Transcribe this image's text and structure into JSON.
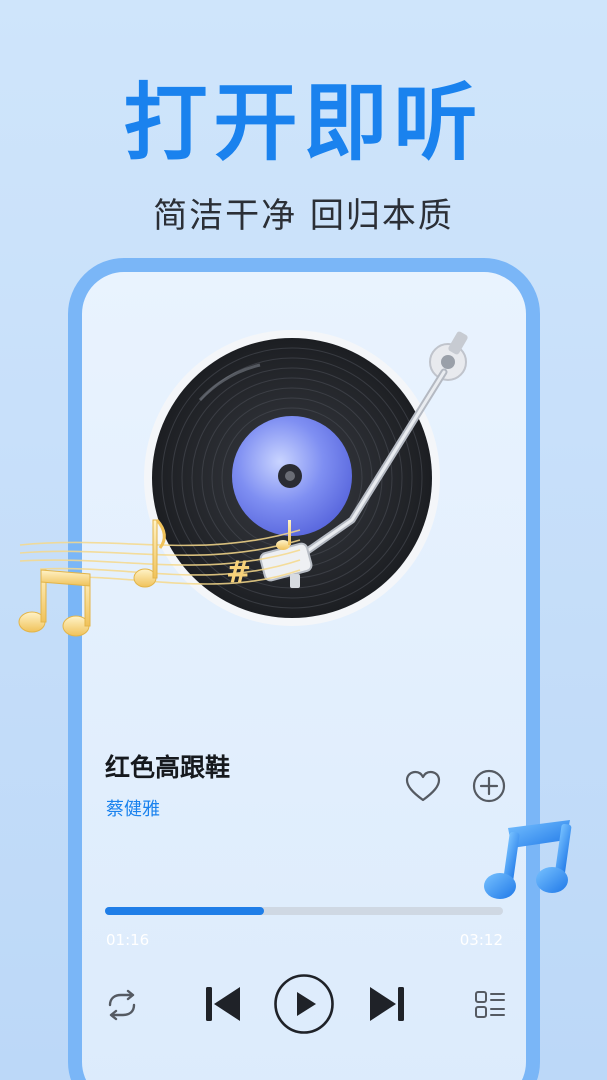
{
  "headline": "打开即听",
  "subtitle": "简洁干净 回归本质",
  "player": {
    "song_title": "红色高跟鞋",
    "artist": "蔡健雅",
    "elapsed": "01:16",
    "duration": "03:12",
    "progress_fraction": 0.4
  },
  "controls": {
    "repeat_icon": "repeat-icon",
    "prev_icon": "skip-previous-icon",
    "play_icon": "play-icon",
    "next_icon": "skip-next-icon",
    "playlist_icon": "playlist-icon",
    "like_icon": "heart-icon",
    "add_icon": "plus-circle-icon"
  },
  "colors": {
    "accent": "#1a82ee",
    "frame": "#7ab6f7",
    "background": "#cfe5fb"
  }
}
